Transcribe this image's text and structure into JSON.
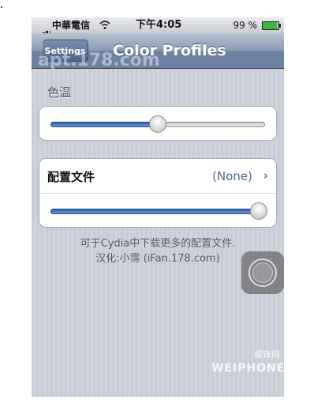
{
  "status_bar": {
    "carrier": "中華電信",
    "time": "下午4:05",
    "battery": "99 %"
  },
  "nav": {
    "back_label": "Settings",
    "title": "Color Profiles"
  },
  "temperature": {
    "label": "色温",
    "slider_value": 0.5
  },
  "profile": {
    "label": "配置文件",
    "value": "(None)",
    "slider_value": 0.97
  },
  "footer": {
    "line1": "可于Cydia中下载更多的配置文件.",
    "line2": "汉化:小霈 (iFan.178.com)"
  },
  "watermarks": {
    "top": "apt.178.com",
    "bottom_cn": "威锋网",
    "bottom": "WEIPHONE.COM"
  }
}
